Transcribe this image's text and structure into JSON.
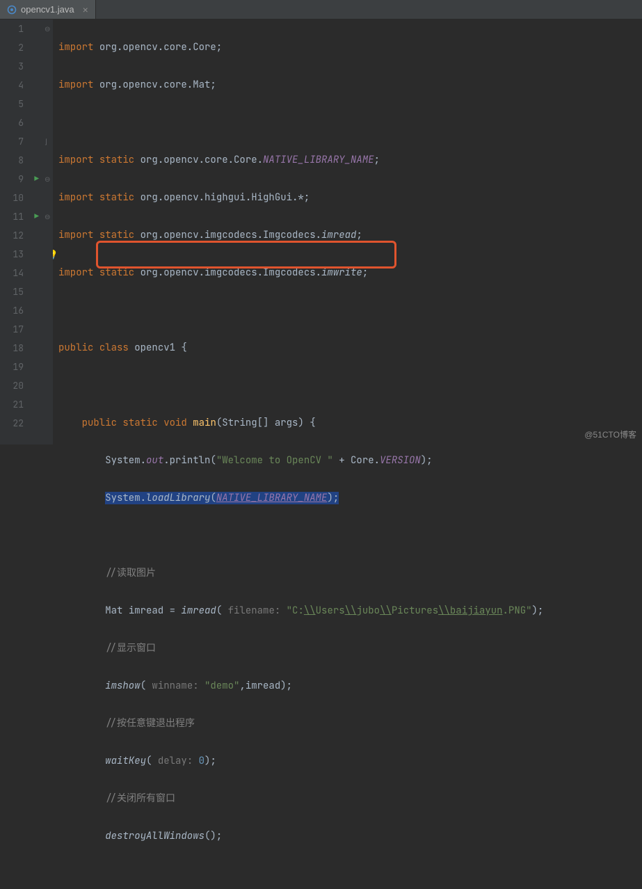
{
  "tab": {
    "filename": "opencv1.java",
    "close": "×"
  },
  "lines": {
    "n1": "1",
    "n2": "2",
    "n3": "3",
    "n4": "4",
    "n5": "5",
    "n6": "6",
    "n7": "7",
    "n8": "8",
    "n9": "9",
    "n10": "10",
    "n11": "11",
    "n12": "12",
    "n13": "13",
    "n14": "14",
    "n15": "15",
    "n16": "16",
    "n17": "17",
    "n18": "18",
    "n19": "19",
    "n20": "20",
    "n21": "21",
    "n22": "22"
  },
  "kw": {
    "import": "import",
    "static": "static",
    "public": "public",
    "class": "class",
    "void": "void"
  },
  "code": {
    "pkg_core": "org.opencv.core.Core",
    "pkg_mat": "org.opencv.core.Mat",
    "pkg_core2": "org.opencv.core.Core.",
    "nat_lib": "NATIVE_LIBRARY_NAME",
    "pkg_highgui": "org.opencv.highgui.HighGui.*",
    "pkg_imgc": "org.opencv.imgcodecs.Imgcodecs.",
    "imread": "imread",
    "imwrite": "imwrite",
    "classname": "opencv1",
    "main": "main",
    "main_args": "(String[] args) {",
    "system": "System",
    "out": "out",
    "println": ".println(",
    "welcome": "\"Welcome to OpenCV \"",
    "plus": " + Core.",
    "version": "VERSION",
    "loadlib": "loadLibrary",
    "loadlib_open": "(",
    "loadlib_close": ");",
    "cmt_read": "//读取图片",
    "mat": "Mat ",
    "imread_var": "imread",
    "eq": " = ",
    "imread_fn": "imread",
    "hint_filename": "filename: ",
    "path_a": "\"C:",
    "path_sep": "\\\\",
    "path_users": "Users",
    "path_jubo": "jubo",
    "path_pictures": "Pictures",
    "path_baijia": "baijiayun",
    "path_ext": ".PNG\"",
    "cmt_show": "//显示窗口",
    "imshow": "imshow",
    "hint_winname": "winname: ",
    "demo": "\"demo\"",
    "imshow_tail": ",imread);",
    "cmt_exit": "//按任意键退出程序",
    "waitkey": "waitKey",
    "hint_delay": "delay: ",
    "zero": "0",
    "cmt_close": "//关闭所有窗口",
    "destroy": "destroyAllWindows",
    "paren_close": "();",
    "semi": ";",
    "brace_open": " {",
    "dot": "."
  },
  "watermark": "@51CTO博客"
}
